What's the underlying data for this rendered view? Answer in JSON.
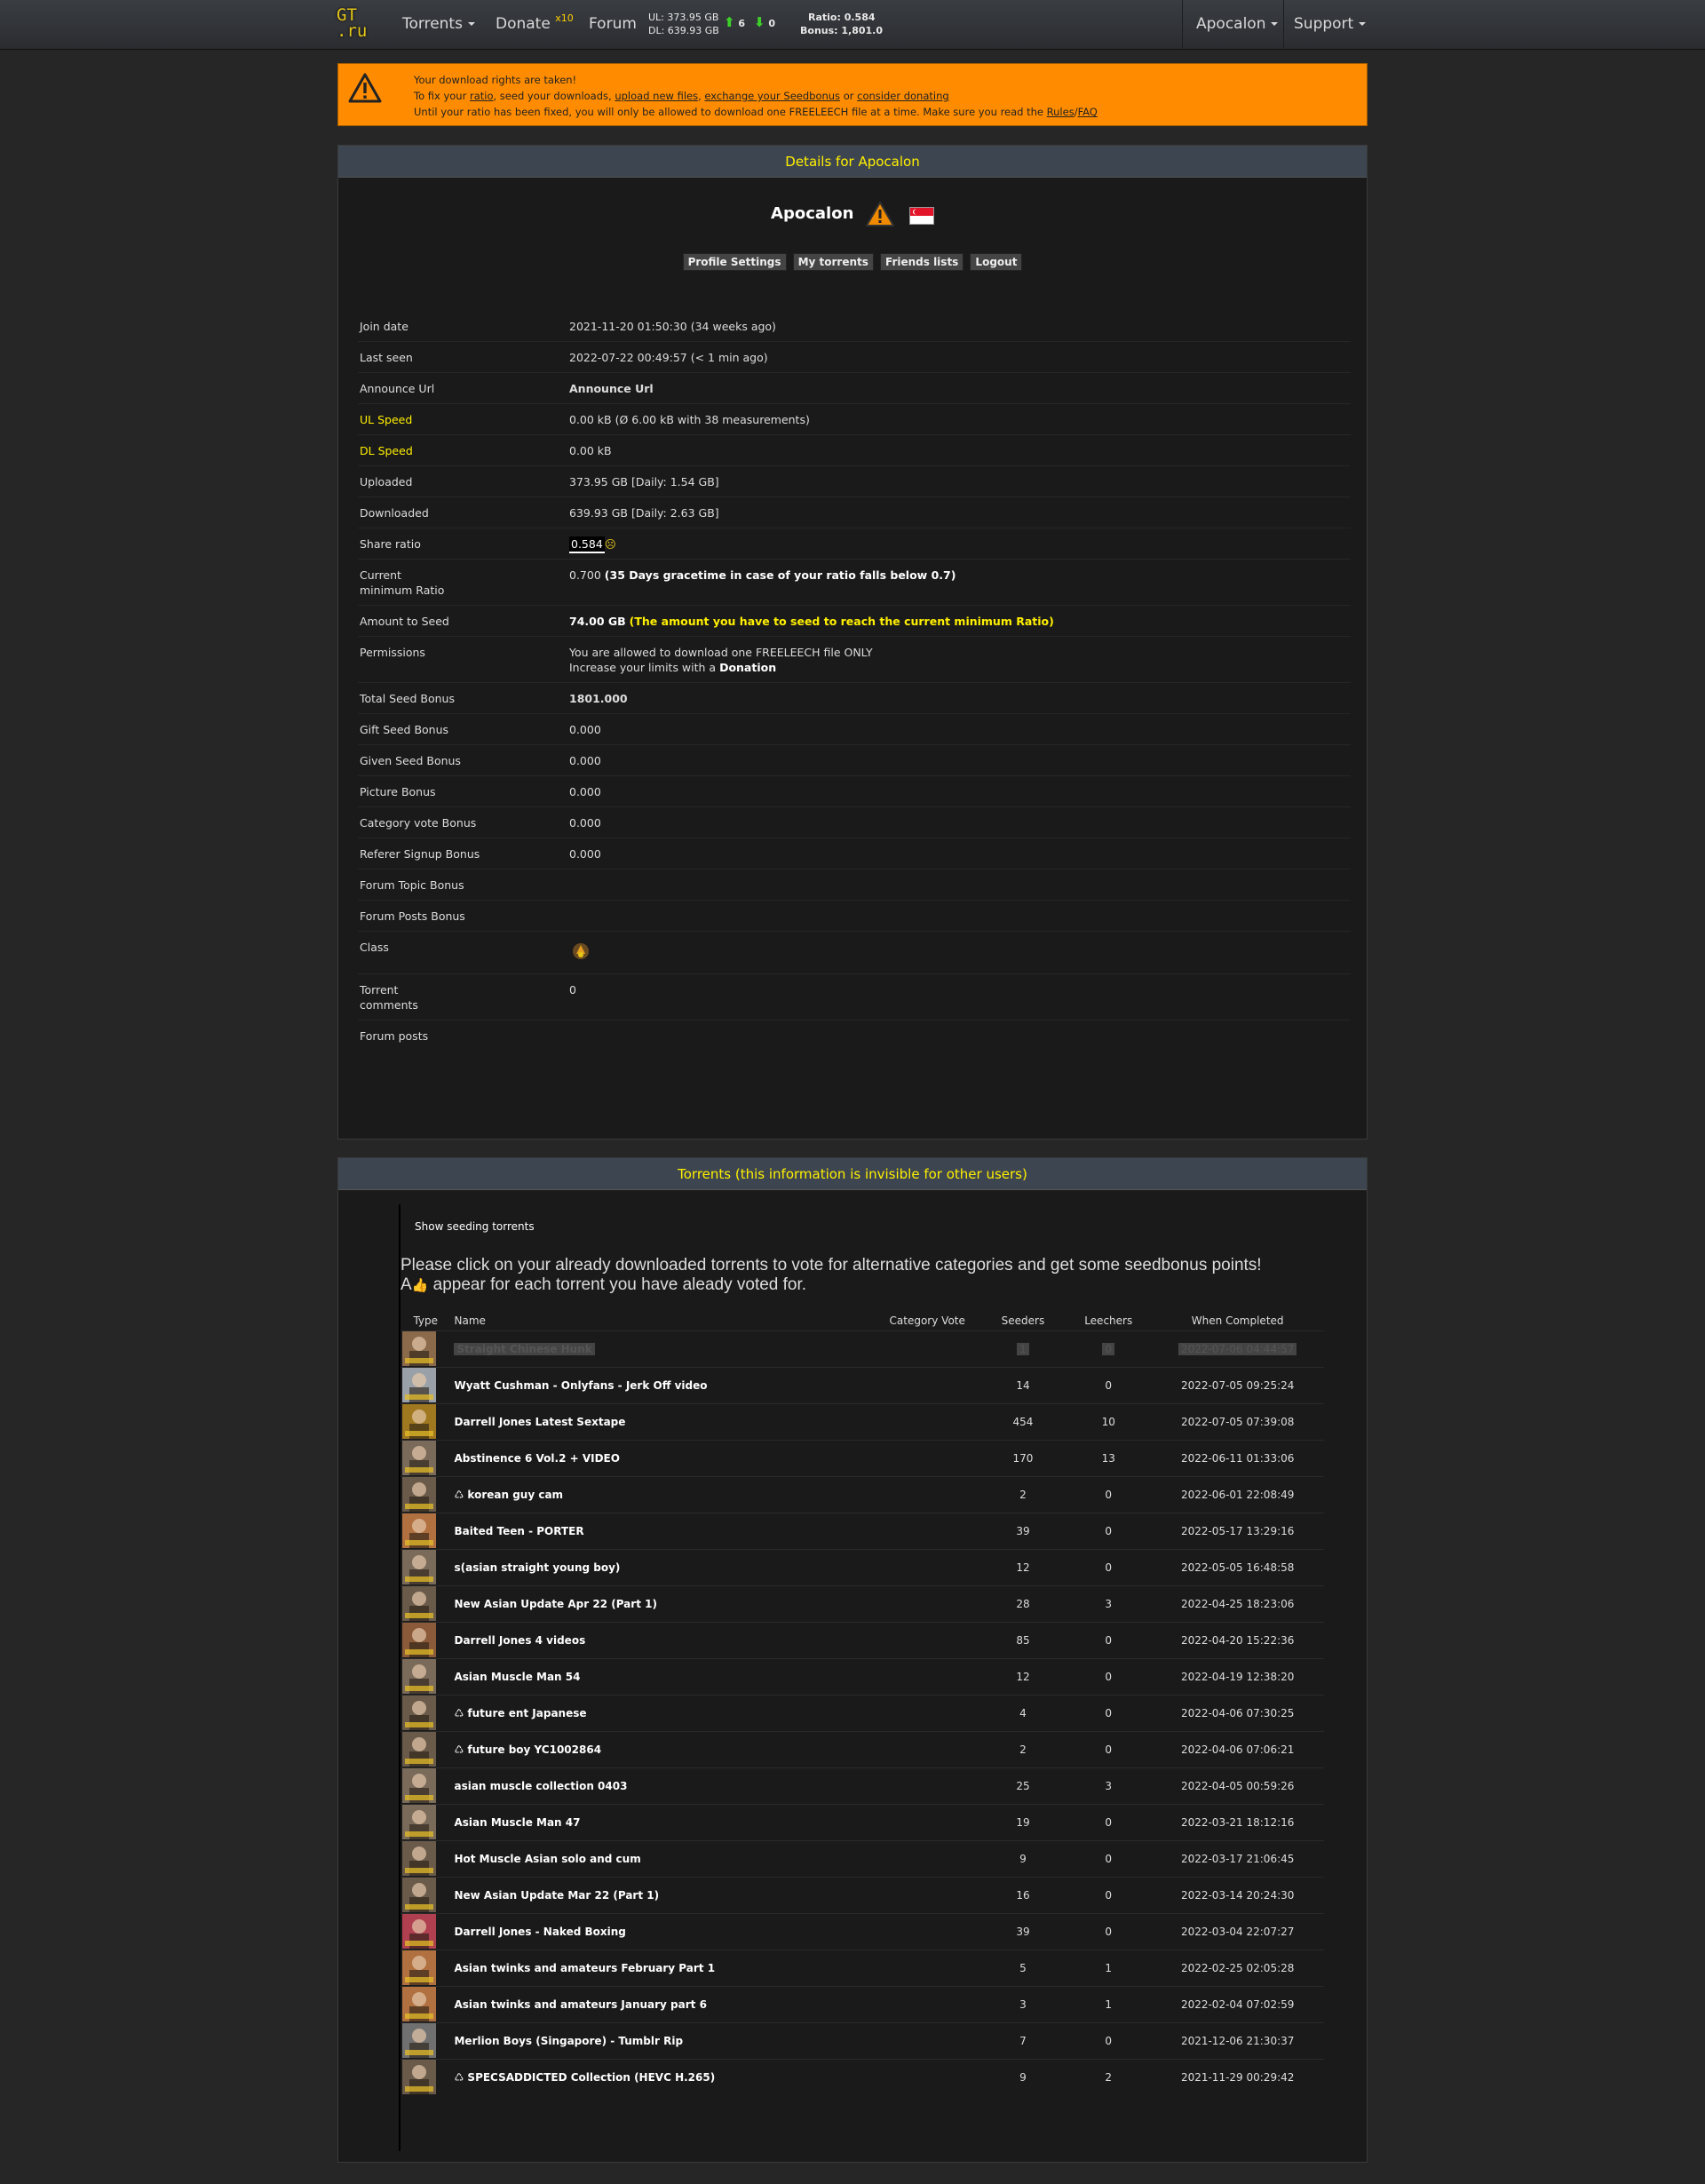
{
  "nav": {
    "logo_line1": "GT",
    "logo_line2": ".ru",
    "torrents": "Torrents",
    "donate": "Donate",
    "donate_badge": "x10",
    "forum": "Forum",
    "ul": "UL: 373.95 GB",
    "dl": "DL: 639.93 GB",
    "seeding_count": "6",
    "leeching_count": "0",
    "ratio": "Ratio: 0.584",
    "bonus": "Bonus: 1,801.0",
    "user_menu": "Apocalon",
    "support": "Support"
  },
  "warning": {
    "line1": "Your download rights are taken!",
    "line2_prefix": "To fix your ",
    "ratio_link": "ratio",
    "line2_mid1": ", seed your downloads, ",
    "upload_link": "upload new files",
    "line2_mid2": ", ",
    "exchange_link": "exchange your Seedbonus",
    "line2_mid3": " or ",
    "donate_link": "consider donating",
    "line3_prefix": "Until your ratio has been fixed, you will only be allowed to download one FREELEECH file at a time. Make sure you read the ",
    "rules_link": "Rules",
    "slash": "/",
    "faq_link": "FAQ"
  },
  "details": {
    "header": "Details for Apocalon",
    "username": "Apocalon",
    "buttons": {
      "profile_settings": "Profile Settings",
      "my_torrents": "My torrents",
      "friends_lists": "Friends lists",
      "logout": "Logout"
    },
    "rows": {
      "join_date_k": "Join date",
      "join_date_v": "2021-11-20 01:50:30 (34 weeks ago)",
      "last_seen_k": "Last seen",
      "last_seen_v": "2022-07-22 00:49:57 (< 1 min ago)",
      "announce_k": "Announce Url",
      "announce_v": "Announce Url",
      "ul_speed_k": "UL Speed",
      "ul_speed_v": "0.00 kB (Ø 6.00 kB with 38 measurements)",
      "dl_speed_k": "DL Speed",
      "dl_speed_v": "0.00 kB",
      "uploaded_k": "Uploaded",
      "uploaded_v": "373.95 GB [Daily: 1.54 GB]",
      "downloaded_k": "Downloaded",
      "downloaded_v": "639.93 GB [Daily: 2.63 GB]",
      "share_ratio_k": "Share ratio",
      "share_ratio_v": "0.584",
      "min_ratio_k1": "Current",
      "min_ratio_k2": "minimum Ratio",
      "min_ratio_v": "0.700",
      "min_ratio_note": "(35 Days gracetime in case of your ratio falls below 0.7)",
      "amount_seed_k": "Amount to Seed",
      "amount_seed_v": "74.00 GB",
      "amount_seed_note": "(The amount you have to seed to reach the current minimum Ratio)",
      "permissions_k": "Permissions",
      "permissions_v1": "You are allowed to download one FREELEECH file ONLY",
      "permissions_v2": "Increase your limits with a ",
      "permissions_link": "Donation",
      "total_seed_k": "Total Seed Bonus",
      "total_seed_v": "1801.000",
      "gift_seed_k": "Gift Seed Bonus",
      "gift_seed_v": "0.000",
      "given_seed_k": "Given Seed Bonus",
      "given_seed_v": "0.000",
      "picture_k": "Picture Bonus",
      "picture_v": "0.000",
      "catvote_k": "Category vote Bonus",
      "catvote_v": "0.000",
      "referer_k": "Referer Signup Bonus",
      "referer_v": "0.000",
      "forum_topic_k": "Forum Topic Bonus",
      "forum_posts_bonus_k": "Forum Posts Bonus",
      "class_k": "Class",
      "comments_k1": "Torrent",
      "comments_k2": "comments",
      "comments_v": "0",
      "forum_posts_k": "Forum posts"
    }
  },
  "torrents": {
    "header": "Torrents (this information is invisible for other users)",
    "show_seeding": "Show seeding torrents",
    "vote_line1": "Please click on your already downloaded torrents to vote for alternative categories and get some seedbonus points!",
    "vote_line2_a": "A",
    "vote_line2_b": " appear for each torrent you have aleady voted for.",
    "columns": [
      "Type",
      "Name",
      "Category Vote",
      "Seeders",
      "Leechers",
      "When Completed"
    ],
    "rows": [
      {
        "name": "Straight Chinese Hunk",
        "seeders": "1",
        "leechers": "0",
        "completed": "2022-07-06 04:44:57",
        "faded": true,
        "thumb": "#8a6a4a"
      },
      {
        "name": "Wyatt Cushman - Onlyfans - Jerk Off video",
        "seeders": "14",
        "leechers": "0",
        "completed": "2022-07-05 09:25:24",
        "thumb": "#9aa0a8"
      },
      {
        "name": "Darrell Jones Latest Sextape",
        "seeders": "454",
        "leechers": "10",
        "completed": "2022-07-05 07:39:08",
        "thumb": "#a07820"
      },
      {
        "name": "Abstinence 6 Vol.2 + VIDEO",
        "seeders": "170",
        "leechers": "13",
        "completed": "2022-06-11 01:33:06",
        "thumb": "#7a6a5a"
      },
      {
        "name": "♺ korean guy cam",
        "seeders": "2",
        "leechers": "0",
        "completed": "2022-06-01 22:08:49",
        "thumb": "#6a5a4a"
      },
      {
        "name": "Baited Teen - PORTER",
        "seeders": "39",
        "leechers": "0",
        "completed": "2022-05-17 13:29:16",
        "thumb": "#b07040"
      },
      {
        "name": "s(asian straight young boy)",
        "seeders": "12",
        "leechers": "0",
        "completed": "2022-05-05 16:48:58",
        "thumb": "#7a6a5a"
      },
      {
        "name": "New Asian Update Apr 22 (Part 1)",
        "seeders": "28",
        "leechers": "3",
        "completed": "2022-04-25 18:23:06",
        "thumb": "#6a5a4a"
      },
      {
        "name": "Darrell Jones 4 videos",
        "seeders": "85",
        "leechers": "0",
        "completed": "2022-04-20 15:22:36",
        "thumb": "#8a5a3a"
      },
      {
        "name": "Asian Muscle Man 54",
        "seeders": "12",
        "leechers": "0",
        "completed": "2022-04-19 12:38:20",
        "thumb": "#7a6a5a"
      },
      {
        "name": "♺ future ent Japanese",
        "seeders": "4",
        "leechers": "0",
        "completed": "2022-04-06 07:30:25",
        "thumb": "#6a5a4a"
      },
      {
        "name": "♺ future boy YC1002864",
        "seeders": "2",
        "leechers": "0",
        "completed": "2022-04-06 07:06:21",
        "thumb": "#6a5a4a"
      },
      {
        "name": "asian muscle collection 0403",
        "seeders": "25",
        "leechers": "3",
        "completed": "2022-04-05 00:59:26",
        "thumb": "#7a6a5a"
      },
      {
        "name": "Asian Muscle Man 47",
        "seeders": "19",
        "leechers": "0",
        "completed": "2022-03-21 18:12:16",
        "thumb": "#7a6a5a"
      },
      {
        "name": "Hot Muscle Asian solo and cum",
        "seeders": "9",
        "leechers": "0",
        "completed": "2022-03-17 21:06:45",
        "thumb": "#6a5a4a"
      },
      {
        "name": "New Asian Update Mar 22 (Part 1)",
        "seeders": "16",
        "leechers": "0",
        "completed": "2022-03-14 20:24:30",
        "thumb": "#6a5a4a"
      },
      {
        "name": "Darrell Jones - Naked Boxing",
        "seeders": "39",
        "leechers": "0",
        "completed": "2022-03-04 22:07:27",
        "thumb": "#b04050"
      },
      {
        "name": "Asian twinks and amateurs February Part 1",
        "seeders": "5",
        "leechers": "1",
        "completed": "2022-02-25 02:05:28",
        "thumb": "#b07040"
      },
      {
        "name": "Asian twinks and amateurs January part 6",
        "seeders": "3",
        "leechers": "1",
        "completed": "2022-02-04 07:02:59",
        "thumb": "#b07040"
      },
      {
        "name": "Merlion Boys (Singapore) - Tumblr Rip",
        "seeders": "7",
        "leechers": "0",
        "completed": "2021-12-06 21:30:37",
        "thumb": "#707070"
      },
      {
        "name": "♺ SPECSADDICTED Collection (HEVC H.265)",
        "seeders": "9",
        "leechers": "2",
        "completed": "2021-11-29 00:29:42",
        "thumb": "#6a5a4a"
      }
    ]
  },
  "colors": {
    "accent": "#ffef00",
    "warning_bg": "#ff8c00",
    "header_bg": "#3d4650"
  }
}
